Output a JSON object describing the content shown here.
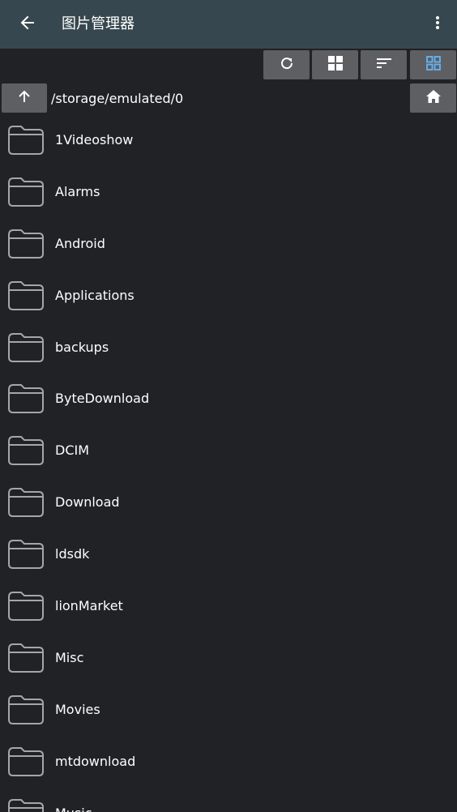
{
  "appbar": {
    "back_icon": "arrow-left-icon",
    "title": "图片管理器",
    "menu_icon": "more-vert-icon"
  },
  "toolbar": {
    "buttons": [
      {
        "icon": "refresh-icon"
      },
      {
        "icon": "grid-large-icon"
      },
      {
        "icon": "sort-icon"
      },
      {
        "icon": "grid-small-icon",
        "color": "#64b5f6"
      }
    ]
  },
  "path_bar": {
    "up_icon": "arrow-up-icon",
    "path": "/storage/emulated/0",
    "home_icon": "home-icon"
  },
  "file_list": {
    "items": [
      {
        "label": "1Videoshow"
      },
      {
        "label": "Alarms"
      },
      {
        "label": "Android"
      },
      {
        "label": "Applications"
      },
      {
        "label": "backups"
      },
      {
        "label": "ByteDownload"
      },
      {
        "label": "DCIM"
      },
      {
        "label": "Download"
      },
      {
        "label": "ldsdk"
      },
      {
        "label": "lionMarket"
      },
      {
        "label": "Misc"
      },
      {
        "label": "Movies"
      },
      {
        "label": "mtdownload"
      },
      {
        "label": "Music"
      }
    ]
  },
  "colors": {
    "appbar": "#37474f",
    "background": "#212226",
    "button": "#5e5f63",
    "accent": "#64b5f6"
  }
}
